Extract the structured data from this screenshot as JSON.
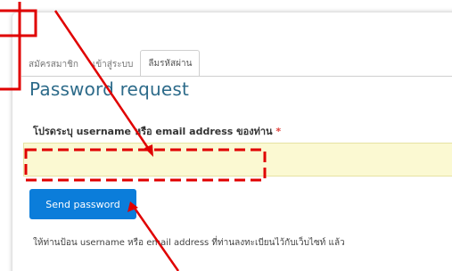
{
  "tabs": [
    {
      "label": "สมัครสมาชิก",
      "active": false
    },
    {
      "label": "เข้าสู่ระบบ",
      "active": false
    },
    {
      "label": "ลืมรหัสผ่าน",
      "active": true
    }
  ],
  "page_title": "Password request",
  "form": {
    "field_label": "โปรดระบุ username หรือ email address ของท่าน",
    "required_mark": "*",
    "field_value": "",
    "submit_label": "Send password"
  },
  "help_text": "ให้ท่านป้อน username หรือ email address ที่ท่านลงทะเบียนไว้กับเว็บไซท์ แล้ว",
  "colors": {
    "title": "#2d6b8a",
    "input_bg": "#fbf9d2",
    "button_bg": "#0b7dda",
    "annotation_red": "#e00000"
  }
}
